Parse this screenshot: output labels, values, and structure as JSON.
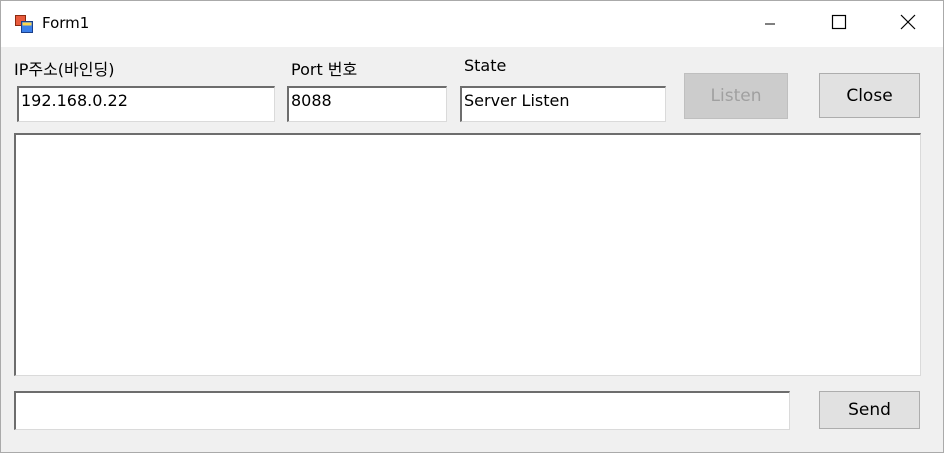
{
  "window": {
    "title": "Form1"
  },
  "form": {
    "ip_label": "IP주소(바인딩)",
    "ip_value": "192.168.0.22",
    "port_label": "Port 번호",
    "port_value": "8088",
    "state_label": "State",
    "state_value": "Server Listen",
    "listen_label": "Listen",
    "close_label": "Close",
    "message_log": "",
    "send_input_value": "",
    "send_label": "Send"
  },
  "icons": {
    "app": "form-app-icon",
    "minimize": "minimize-icon",
    "maximize": "maximize-icon",
    "close": "close-icon"
  }
}
